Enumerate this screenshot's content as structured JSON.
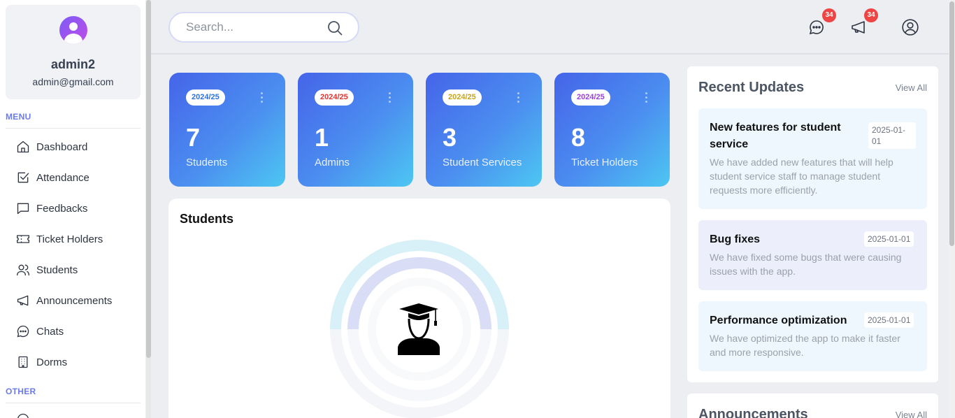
{
  "sidebar": {
    "profile": {
      "name": "admin2",
      "email": "admin@gmail.com"
    },
    "menu_label": "MENU",
    "items": [
      {
        "label": "Dashboard",
        "icon": "home-icon"
      },
      {
        "label": "Attendance",
        "icon": "checkbox-icon"
      },
      {
        "label": "Feedbacks",
        "icon": "message-square-icon"
      },
      {
        "label": "Ticket Holders",
        "icon": "ticket-icon"
      },
      {
        "label": "Students",
        "icon": "users-icon"
      },
      {
        "label": "Announcements",
        "icon": "megaphone-icon"
      },
      {
        "label": "Chats",
        "icon": "chat-icon"
      },
      {
        "label": "Dorms",
        "icon": "building-icon"
      }
    ],
    "other_label": "OTHER"
  },
  "topbar": {
    "search_placeholder": "Search...",
    "chat_badge": "34",
    "announce_badge": "34"
  },
  "stats": [
    {
      "year": "2024/25",
      "year_color": "#2f6fe0",
      "value": "7",
      "label": "Students"
    },
    {
      "year": "2024/25",
      "year_color": "#e0352f",
      "value": "1",
      "label": "Admins"
    },
    {
      "year": "2024/25",
      "year_color": "#c9a417",
      "value": "3",
      "label": "Student Services"
    },
    {
      "year": "2024/25",
      "year_color": "#9b3fe0",
      "value": "8",
      "label": "Ticket Holders"
    }
  ],
  "students_panel": {
    "title": "Students"
  },
  "recent_updates": {
    "title": "Recent Updates",
    "view_all": "View All",
    "items": [
      {
        "title": "New features for student service",
        "date": "2025-01-01",
        "body": "We have added new features that will help student service staff to manage student requests more efficiently."
      },
      {
        "title": "Bug fixes",
        "date": "2025-01-01",
        "body": "We have fixed some bugs that were causing issues with the app."
      },
      {
        "title": "Performance optimization",
        "date": "2025-01-01",
        "body": "We have optimized the app to make it faster and more responsive."
      }
    ]
  },
  "announcements": {
    "title": "Announcements",
    "view_all": "View All"
  },
  "colors": {
    "accent": "#6b7bef",
    "badge": "#ef4444",
    "update_blue": "#eef7fd",
    "update_lavender": "#eceefb"
  }
}
